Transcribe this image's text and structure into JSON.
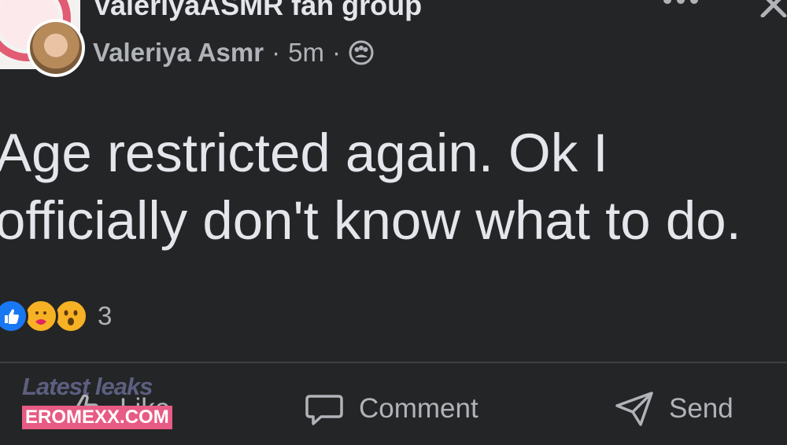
{
  "header": {
    "group_name": "ValeriyaASMR fan group",
    "author": "Valeriya Asmr",
    "time": "5m",
    "separator": "·",
    "privacy_icon": "group-privacy-icon",
    "more_icon": "more-icon",
    "close_icon": "close-icon"
  },
  "post": {
    "text": "Age restricted again. Ok I officially don't know what to do."
  },
  "reactions": {
    "icons": [
      "like-reaction-icon",
      "care-reaction-icon",
      "wow-reaction-icon"
    ],
    "count": "3"
  },
  "actions": {
    "like_label": "Like",
    "comment_label": "Comment",
    "send_label": "Send"
  },
  "watermark": {
    "line1": "Latest leaks",
    "line2": "EROMEXX.COM"
  },
  "colors": {
    "background": "#242526",
    "text_primary": "#e4e6eb",
    "text_secondary": "#b0b3b8",
    "like_blue": "#1877f2",
    "reaction_yellow": "#f7b125",
    "watermark_pink": "#e75b84"
  }
}
